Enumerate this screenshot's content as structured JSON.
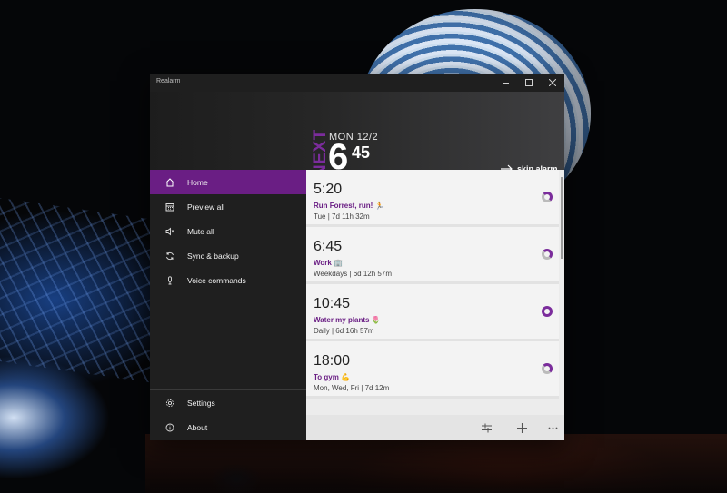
{
  "window": {
    "title": "Realarm"
  },
  "next_alarm": {
    "tag": "NEXT",
    "date": "MON 12/2",
    "hour": "6",
    "minute": "45",
    "skip_label": "skip alarm"
  },
  "sidebar": {
    "items": [
      {
        "label": "Home",
        "icon": "home-icon",
        "active": true
      },
      {
        "label": "Preview all",
        "icon": "calendar-icon",
        "active": false
      },
      {
        "label": "Mute all",
        "icon": "mute-icon",
        "active": false
      },
      {
        "label": "Sync & backup",
        "icon": "sync-icon",
        "active": false
      },
      {
        "label": "Voice commands",
        "icon": "microphone-icon",
        "active": false
      }
    ],
    "footer": [
      {
        "label": "Settings",
        "icon": "gear-icon"
      },
      {
        "label": "About",
        "icon": "info-icon"
      }
    ]
  },
  "alarms": [
    {
      "time": "5:20",
      "name": "Run Forrest, run! 🏃",
      "schedule": "Tue | 7d 11h 32m",
      "enabled": false
    },
    {
      "time": "6:45",
      "name": "Work 🏢",
      "schedule": "Weekdays | 6d 12h 57m",
      "enabled": false
    },
    {
      "time": "10:45",
      "name": "Water my plants 🌷",
      "schedule": "Daily | 6d 16h 57m",
      "enabled": true
    },
    {
      "time": "18:00",
      "name": "To gym 💪",
      "schedule": "Mon, Wed, Fri | 7d 12m",
      "enabled": false
    }
  ],
  "commands": [
    "filter-icon",
    "add-icon",
    "more-icon"
  ],
  "colors": {
    "accent": "#6a1e84",
    "accent_text": "#7b2c9c"
  }
}
